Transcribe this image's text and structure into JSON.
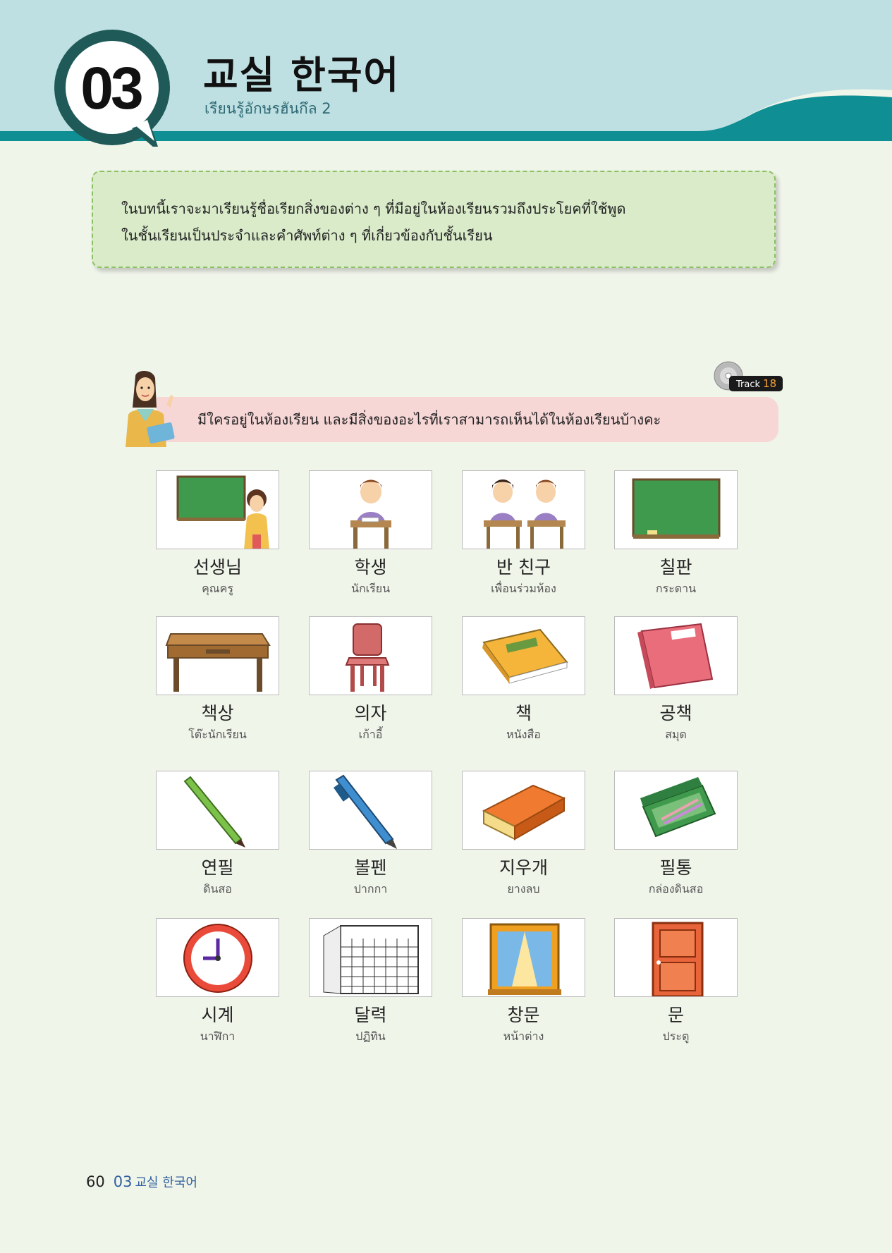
{
  "header": {
    "lesson_number": "03",
    "title": "교실 한국어",
    "subtitle": "เรียนรู้อักษรฮันกึล  2"
  },
  "intro": {
    "line1": "ในบทนี้เราจะมาเรียนรู้ชื่อเรียกสิ่งของต่าง ๆ ที่มีอยู่ในห้องเรียนรวมถึงประโยคที่ใช้พูด",
    "line2": "ในชั้นเรียนเป็นประจำและคำศัพท์ต่าง ๆ ที่เกี่ยวข้องกับชั้นเรียน"
  },
  "track": {
    "label": "Track",
    "number": "18"
  },
  "prompt": "มีใครอยู่ในห้องเรียน และมีสิ่งของอะไรที่เราสามารถเห็นได้ในห้องเรียนบ้างคะ",
  "vocab": [
    {
      "korean": "선생님",
      "thai": "คุณครู",
      "icon": "teacher-blackboard-icon"
    },
    {
      "korean": "학생",
      "thai": "นักเรียน",
      "icon": "student-icon"
    },
    {
      "korean": "반 친구",
      "thai": "เพื่อนร่วมห้อง",
      "icon": "classmates-icon"
    },
    {
      "korean": "칠판",
      "thai": "กระดาน",
      "icon": "blackboard-icon"
    },
    {
      "korean": "책상",
      "thai": "โต๊ะนักเรียน",
      "icon": "desk-icon"
    },
    {
      "korean": "의자",
      "thai": "เก้าอี้",
      "icon": "chair-icon"
    },
    {
      "korean": "책",
      "thai": "หนังสือ",
      "icon": "book-icon"
    },
    {
      "korean": "공책",
      "thai": "สมุด",
      "icon": "notebook-icon"
    },
    {
      "korean": "연필",
      "thai": "ดินสอ",
      "icon": "pencil-icon"
    },
    {
      "korean": "볼펜",
      "thai": "ปากกา",
      "icon": "pen-icon"
    },
    {
      "korean": "지우개",
      "thai": "ยางลบ",
      "icon": "eraser-icon"
    },
    {
      "korean": "필통",
      "thai": "กล่องดินสอ",
      "icon": "pencil-case-icon"
    },
    {
      "korean": "시계",
      "thai": "นาฬิกา",
      "icon": "clock-icon"
    },
    {
      "korean": "달력",
      "thai": "ปฏิทิน",
      "icon": "calendar-icon"
    },
    {
      "korean": "창문",
      "thai": "หน้าต่าง",
      "icon": "window-icon"
    },
    {
      "korean": "문",
      "thai": "ประตู",
      "icon": "door-icon"
    }
  ],
  "footer": {
    "page_number": "60",
    "chapter": "03",
    "chapter_title": "교실 한국어"
  },
  "colors": {
    "header_bg": "#bfe0e3",
    "teal_band": "#0f8f93",
    "badge": "#1f5a58",
    "intro_bg": "#d9ebc9",
    "speech_bg": "#f7d6d6",
    "page_bg": "#f0f5ea"
  }
}
